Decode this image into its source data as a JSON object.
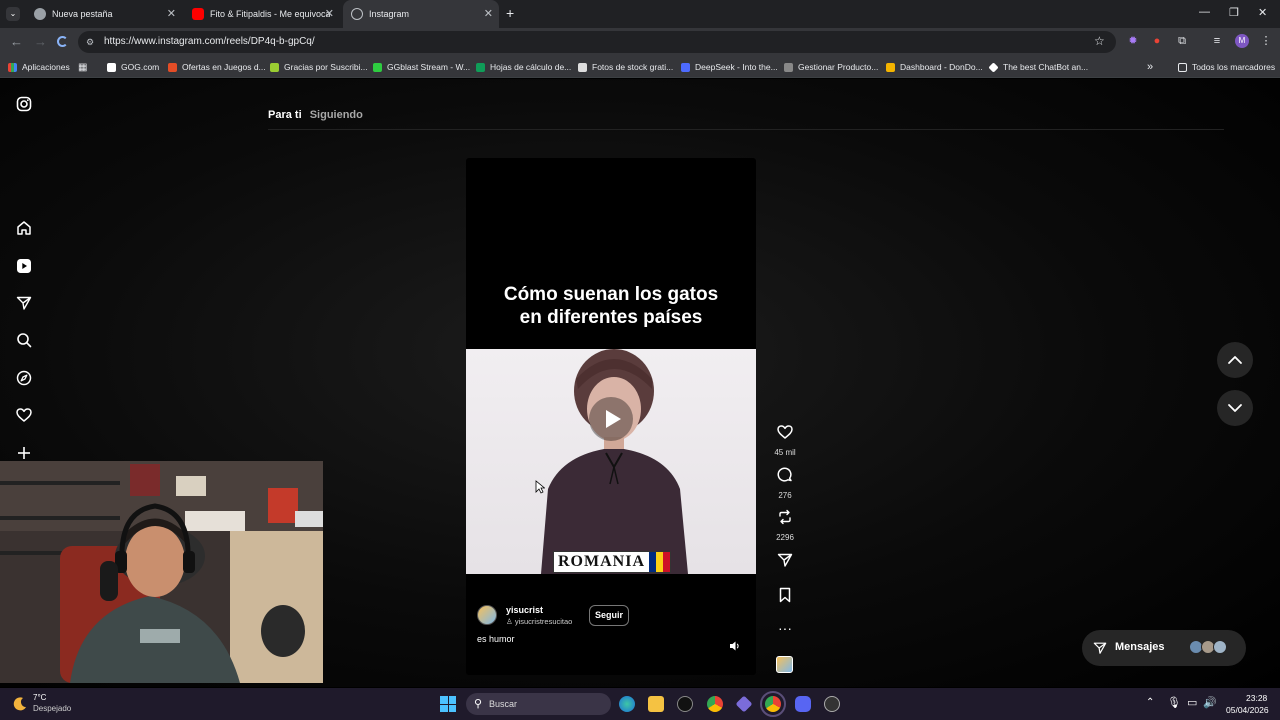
{
  "browser": {
    "tabs": [
      {
        "label": "Nueva pestaña",
        "icon": "chrome-icon",
        "active": false
      },
      {
        "label": "Fito & Fitipaldis - Me equivocaría otra vez",
        "icon": "youtube-icon",
        "active": false
      },
      {
        "label": "Instagram",
        "icon": "instagram-icon",
        "active": true
      }
    ],
    "new_tab": "+",
    "url": "https://www.instagram.com/reels/DP4q-b-gpCq/",
    "bookmarks": [
      {
        "label": "Aplicaciones",
        "color": "#ea4335"
      },
      {
        "label": "GOG.com",
        "color": "#7a5cff"
      },
      {
        "label": "Ofertas en Juegos d...",
        "color": "#e44d26"
      },
      {
        "label": "Gracias por Suscribi...",
        "color": "#9acd32"
      },
      {
        "label": "GGblast Stream - W...",
        "color": "#2ecc40"
      },
      {
        "label": "Hojas de cálculo de...",
        "color": "#0f9d58"
      },
      {
        "label": "Fotos de stock grati...",
        "color": "#dddddd"
      },
      {
        "label": "DeepSeek - Into the...",
        "color": "#4d6bfe"
      },
      {
        "label": "Gestionar Producto...",
        "color": "#888888"
      },
      {
        "label": "Dashboard - DonDo...",
        "color": "#f4b400"
      },
      {
        "label": "The best ChatBot an...",
        "color": "#ffffff"
      }
    ],
    "bookmarks_more": "»",
    "all_bookmarks": "Todos los marcadores"
  },
  "instagram": {
    "feed_tabs": {
      "for_you": "Para ti",
      "following": "Siguiendo"
    },
    "reel": {
      "caption_line1": "Cómo suenan los gatos",
      "caption_line2": "en diferentes países",
      "video_label": "ROMANIA",
      "username": "yisucrist",
      "audio": "yisucristresucitao",
      "follow": "Seguir",
      "description": "es humor"
    },
    "actions": {
      "likes": "45 mil",
      "comments": "276",
      "reposts": "2296"
    },
    "messages_label": "Mensajes",
    "colors": {
      "flag_blue": "#002b7f",
      "flag_yellow": "#fcd116",
      "flag_red": "#ce1126"
    }
  },
  "taskbar": {
    "weather_temp": "7°C",
    "weather_desc": "Despejado",
    "search_placeholder": "Buscar",
    "time": "23:28",
    "date": "05/04/2026"
  }
}
